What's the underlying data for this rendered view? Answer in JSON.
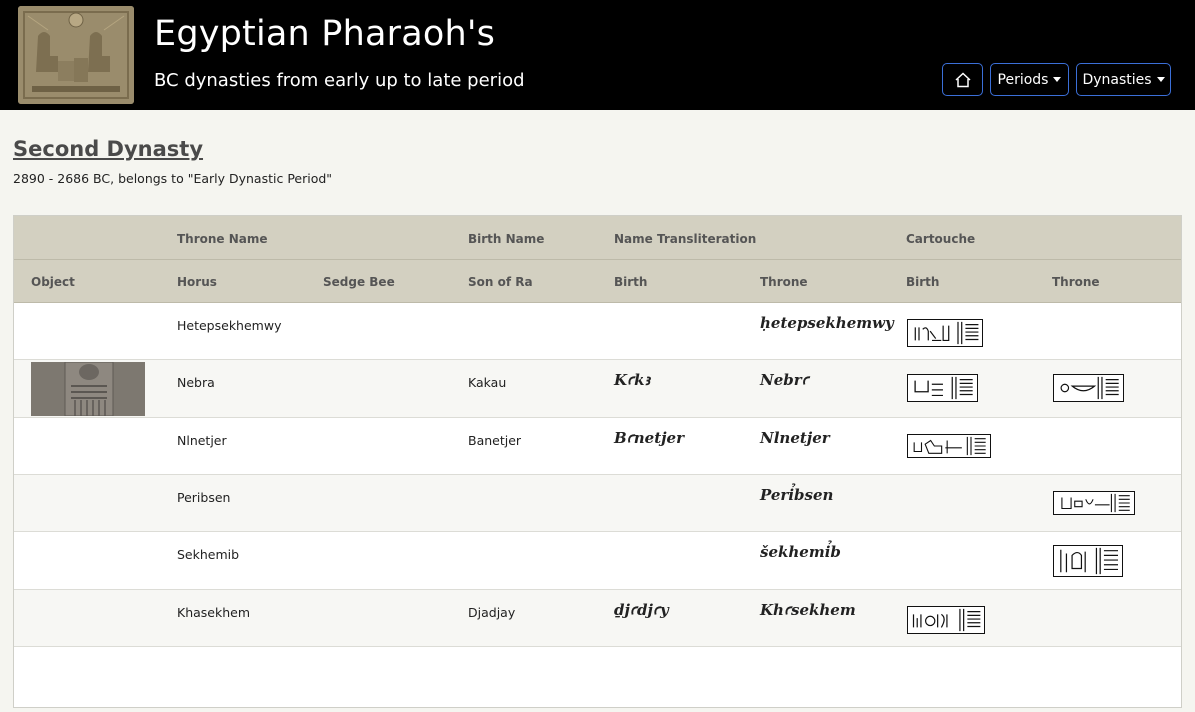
{
  "header": {
    "title": "Egyptian Pharaoh's",
    "subtitle": "BC dynasties from early up to late period",
    "nav": {
      "periods": "Periods",
      "dynasties": "Dynasties"
    }
  },
  "page": {
    "title": "Second Dynasty",
    "subtitle": "2890 - 2686 BC, belongs to \"Early Dynastic Period\""
  },
  "table": {
    "group_headers": {
      "throne_name": "Throne Name",
      "birth_name": "Birth Name",
      "name_transliteration": "Name Transliteration",
      "cartouche": "Cartouche"
    },
    "columns": {
      "object": "Object",
      "horus": "Horus",
      "sedge_bee": "Sedge Bee",
      "son_of_ra": "Son of Ra",
      "birth": "Birth",
      "throne": "Throne",
      "cartouche_birth": "Birth",
      "cartouche_throne": "Throne"
    },
    "rows": [
      {
        "horus": "Hetepsekhemwy",
        "son_of_ra": "",
        "birth_translit": "",
        "throne_translit": "ḥetepsekhemwy",
        "has_object": false,
        "cartouche_birth": true,
        "cartouche_throne": false
      },
      {
        "horus": "Nebra",
        "son_of_ra": "Kakau",
        "birth_translit": "Kꜥkꜣ",
        "throne_translit": "Nebrꜥ",
        "has_object": true,
        "cartouche_birth": true,
        "cartouche_throne": true
      },
      {
        "horus": "Nlnetjer",
        "son_of_ra": "Banetjer",
        "birth_translit": "Bꜥnetjer",
        "throne_translit": "Nlnetjer",
        "has_object": false,
        "cartouche_birth": true,
        "cartouche_throne": false
      },
      {
        "horus": "Peribsen",
        "son_of_ra": "",
        "birth_translit": "",
        "throne_translit": "Perỉbsen",
        "has_object": false,
        "cartouche_birth": false,
        "cartouche_throne": true
      },
      {
        "horus": "Sekhemib",
        "son_of_ra": "",
        "birth_translit": "",
        "throne_translit": "šekhemỉb",
        "has_object": false,
        "cartouche_birth": false,
        "cartouche_throne": true
      },
      {
        "horus": "Khasekhem",
        "son_of_ra": "Djadjay",
        "birth_translit": "ḏjꜥdjꜥy",
        "throne_translit": "Khꜥsekhem",
        "has_object": false,
        "cartouche_birth": true,
        "cartouche_throne": false
      }
    ]
  }
}
